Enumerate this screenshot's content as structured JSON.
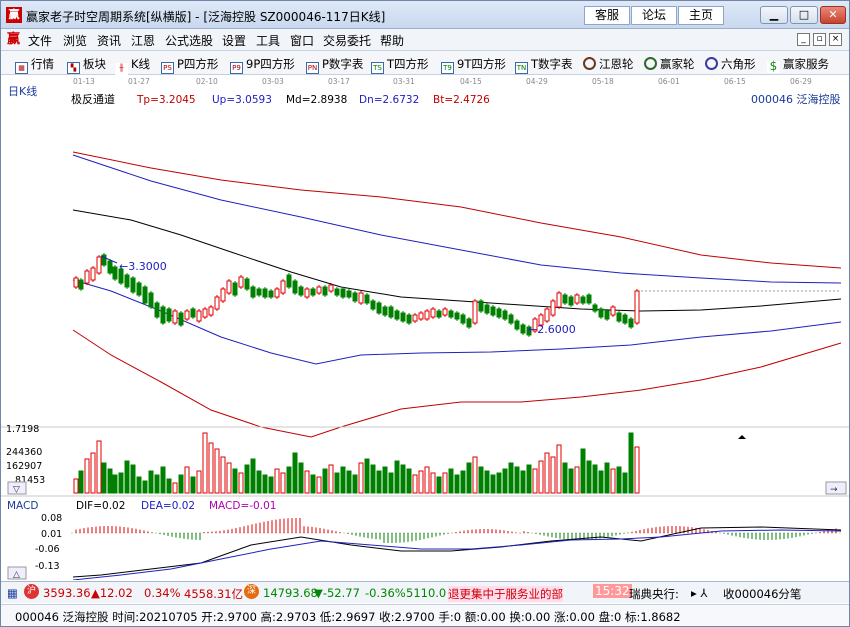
{
  "window": {
    "title": "赢家老子时空周期系统[纵横版] - [泛海控股  SZ000046-117日K线]",
    "links": [
      "客服",
      "论坛",
      "主页"
    ]
  },
  "menu": [
    "文件",
    "浏览",
    "资讯",
    "江恩",
    "公式选股",
    "设置",
    "工具",
    "窗口",
    "交易委托",
    "帮助"
  ],
  "toolbar": [
    "行情",
    "板块",
    "K线",
    "P四方形",
    "9P四方形",
    "P数字表",
    "T四方形",
    "9T四方形",
    "T数字表",
    "江恩轮",
    "赢家轮",
    "六角形",
    "赢家服务"
  ],
  "chart": {
    "period_label": "日K线",
    "dates": [
      "01-13",
      "01-27",
      "02-10",
      "03-03",
      "03-17",
      "03-31",
      "04-15",
      "04-29",
      "05-18",
      "06-01",
      "06-15",
      "06-29"
    ],
    "indicator": {
      "name": "极反通道",
      "tp": "Tp=3.2045",
      "up": "Up=3.0593",
      "md": "Md=2.8938",
      "dn": "Dn=2.6732",
      "bt": "Bt=2.4726"
    },
    "stock_label": "000046  泛海控股",
    "high_mark": "3.3000",
    "low_mark": "2.6000",
    "volume_labels": [
      "1.7198",
      "244360",
      "162907",
      "81453"
    ],
    "macd": {
      "name": "MACD",
      "dif": "DIF=0.02",
      "dea": "DEA=0.02",
      "macd": "MACD=-0.01",
      "axis": [
        "0.08",
        "0.01",
        "-0.06",
        "-0.13"
      ]
    }
  },
  "status": {
    "sh_index": "3593.36",
    "sh_change": "▲12.02",
    "sh_pct": "0.34%",
    "sh_amount": "4558.31亿",
    "sz_index": "14793.68",
    "sz_change": "▼-52.77",
    "sz_pct": "-0.36%",
    "sz_amount": "5110.0",
    "news": "退更集中于服务业的部",
    "time": "15:32",
    "news2": "瑞典央行:",
    "alert": "收000046分笔"
  },
  "info": {
    "text": "000046 泛海控股 时间:20210705 开:2.9700 高:2.9703 低:2.9697 收:2.9700 手:0 额:0.00 换:0.00 涨:0.00 盘:0 标:1.8682"
  },
  "colors": {
    "up": "#e00000",
    "down": "#008000",
    "blue_line": "#2020c0",
    "red_line": "#c00000"
  }
}
